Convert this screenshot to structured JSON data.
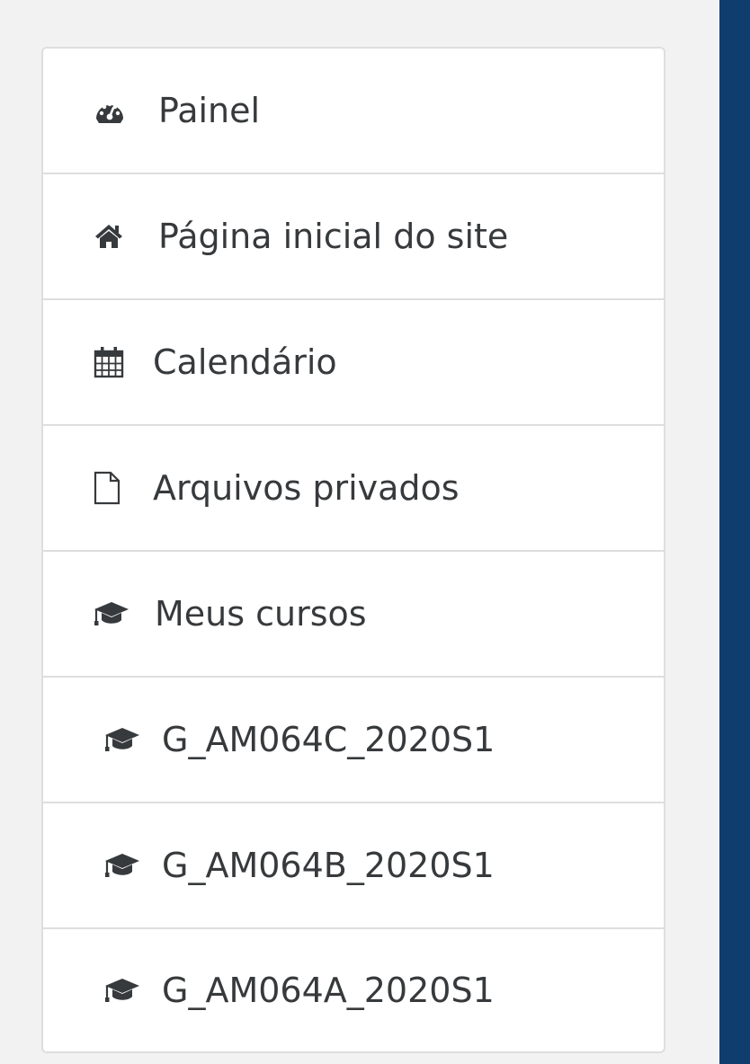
{
  "colors": {
    "page_background": "#f2f2f2",
    "item_background": "#ffffff",
    "item_border": "#dedede",
    "text": "#373a3c",
    "icon": "#373a3c",
    "right_bar": "#0f3e6e"
  },
  "nav": {
    "items": [
      {
        "label": "Painel",
        "icon": "dashboard-icon"
      },
      {
        "label": "Página inicial do site",
        "icon": "home-icon"
      },
      {
        "label": "Calendário",
        "icon": "calendar-icon"
      },
      {
        "label": "Arquivos privados",
        "icon": "file-icon"
      },
      {
        "label": "Meus cursos",
        "icon": "graduation-cap-icon"
      },
      {
        "label": "G_AM064C_2020S1",
        "icon": "graduation-cap-icon"
      },
      {
        "label": "G_AM064B_2020S1",
        "icon": "graduation-cap-icon"
      },
      {
        "label": "G_AM064A_2020S1",
        "icon": "graduation-cap-icon"
      }
    ]
  }
}
